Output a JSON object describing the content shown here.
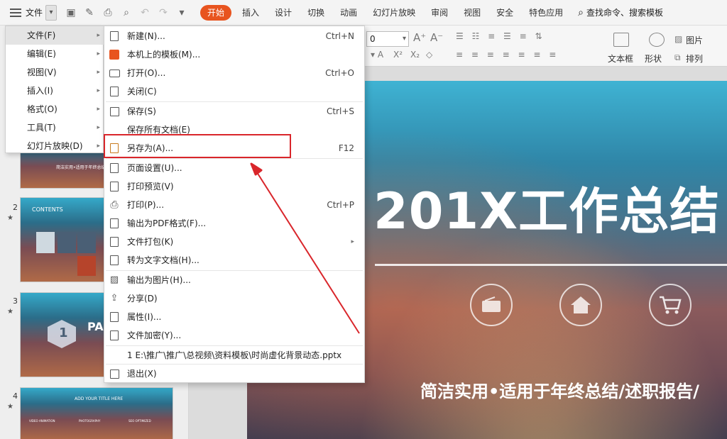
{
  "topbar": {
    "file_label": "文件",
    "tabs": [
      "开始",
      "插入",
      "设计",
      "切换",
      "动画",
      "幻灯片放映",
      "审阅",
      "视图",
      "安全",
      "特色应用"
    ],
    "search_label": "查找命令、搜索模板"
  },
  "ribbon": {
    "font_size": "0",
    "textbox_label": "文本框",
    "shape_label": "形状",
    "picture_label": "图片",
    "arrange_label": "排列"
  },
  "menu1": {
    "items": [
      {
        "label": "文件(F)"
      },
      {
        "label": "编辑(E)"
      },
      {
        "label": "视图(V)"
      },
      {
        "label": "插入(I)"
      },
      {
        "label": "格式(O)"
      },
      {
        "label": "工具(T)"
      },
      {
        "label": "幻灯片放映(D)"
      }
    ]
  },
  "menu2": {
    "items": [
      {
        "label": "新建(N)...",
        "shortcut": "Ctrl+N"
      },
      {
        "label": "本机上的模板(M)...",
        "shortcut": ""
      },
      {
        "label": "打开(O)...",
        "shortcut": "Ctrl+O"
      },
      {
        "label": "关闭(C)",
        "shortcut": ""
      },
      {
        "label": "保存(S)",
        "shortcut": "Ctrl+S"
      },
      {
        "label": "保存所有文档(E)",
        "shortcut": ""
      },
      {
        "label": "另存为(A)...",
        "shortcut": "F12"
      },
      {
        "label": "页面设置(U)...",
        "shortcut": ""
      },
      {
        "label": "打印预览(V)",
        "shortcut": ""
      },
      {
        "label": "打印(P)...",
        "shortcut": "Ctrl+P"
      },
      {
        "label": "输出为PDF格式(F)...",
        "shortcut": ""
      },
      {
        "label": "文件打包(K)",
        "shortcut": ""
      },
      {
        "label": "转为文字文档(H)...",
        "shortcut": ""
      },
      {
        "label": "输出为图片(H)...",
        "shortcut": ""
      },
      {
        "label": "分享(D)",
        "shortcut": ""
      },
      {
        "label": "属性(I)...",
        "shortcut": ""
      },
      {
        "label": "文件加密(Y)...",
        "shortcut": ""
      },
      {
        "label": "1 E:\\推广\\推广\\总视频\\资料模板\\时尚虚化背景动态.pptx",
        "shortcut": ""
      },
      {
        "label": "退出(X)",
        "shortcut": ""
      }
    ]
  },
  "thumbnails": {
    "numbers": [
      "2",
      "3",
      "4"
    ],
    "slide1_caption": "简洁实用•适用于年终总结/述职报告",
    "slide2_heading": "CONTENTS",
    "slide3_heading": "PA",
    "slide3_number": "1",
    "slide4_heading": "ADD YOUR TITLE HERE",
    "slide4_cols": [
      "VIDEO ANIMATION",
      "PHOTOGRAPHY",
      "SEO OPTIMIZED"
    ]
  },
  "slide": {
    "title": "201X工作总结",
    "subtitle": "简洁实用•适用于年终总结/述职报告/"
  },
  "colors": {
    "accent": "#e8541f",
    "highlight_box": "#d9262b"
  }
}
